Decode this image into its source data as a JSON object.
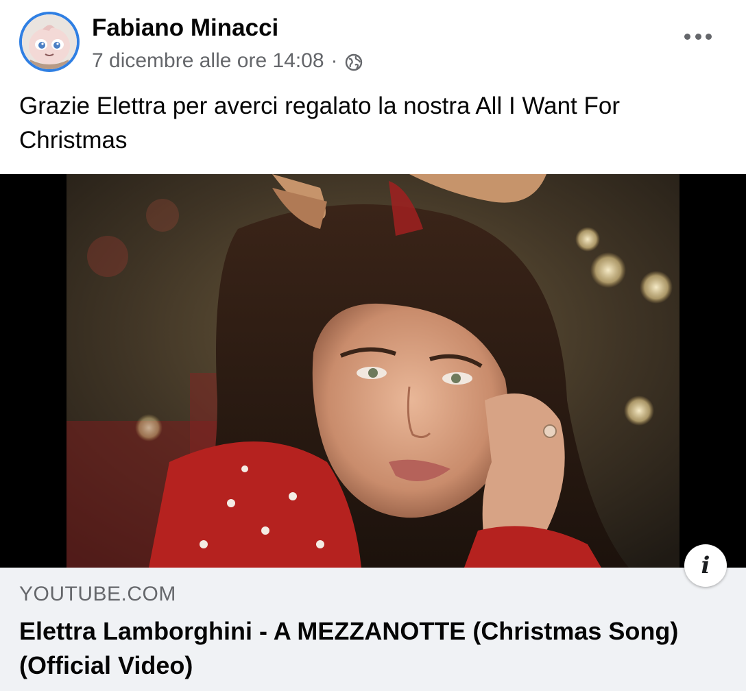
{
  "post": {
    "author": "Fabiano Minacci",
    "timestamp": "7 dicembre alle ore 14:08",
    "separator": "·",
    "privacy_icon": "globe-icon",
    "more_icon": "more-options-icon",
    "text": "Grazie Elettra per averci regalato la nostra All I Want For Christmas"
  },
  "link_preview": {
    "domain": "YOUTUBE.COM",
    "title": "Elettra Lamborghini - A MEZZANOTTE (Christmas Song) (Official Video)",
    "info_icon": "info-icon",
    "info_glyph": "i"
  },
  "colors": {
    "avatar_ring": "#2f7fe3",
    "secondary_text": "#65676b",
    "card_bg": "#f0f2f5"
  }
}
